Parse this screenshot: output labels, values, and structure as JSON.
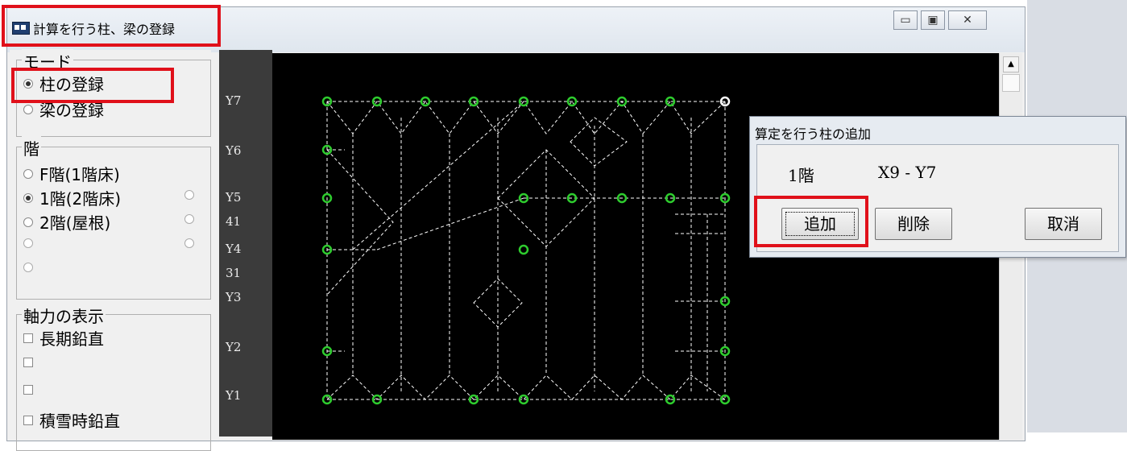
{
  "window": {
    "title": "計算を行う柱、梁の登録",
    "controls": {
      "minimize": "▭",
      "maximize": "▣",
      "close": "✕"
    }
  },
  "mode_group": {
    "title": "モード",
    "options": [
      {
        "label": "柱の登録",
        "selected": true
      },
      {
        "label": "梁の登録",
        "selected": false
      }
    ]
  },
  "floor_group": {
    "title": "階",
    "options": [
      {
        "label": "F階(1階床)",
        "selected": false
      },
      {
        "label": "1階(2階床)",
        "selected": true
      },
      {
        "label": "2階(屋根)",
        "selected": false
      }
    ]
  },
  "axial_group": {
    "title": "軸力の表示",
    "options": [
      {
        "label": "長期鉛直",
        "checked": false
      },
      {
        "label": "",
        "checked": false
      },
      {
        "label": "",
        "checked": false
      },
      {
        "label": "積雪時鉛直",
        "checked": false
      }
    ]
  },
  "axis_labels": [
    "Y7",
    "Y6",
    "Y5",
    "41",
    "Y4",
    "31",
    "Y3",
    "Y2",
    "Y1"
  ],
  "colors": {
    "column_marker": "#2ecc2e",
    "highlight": "#e0101a",
    "grid_line": "#ffffff"
  },
  "dialog": {
    "title": "算定を行う柱の追加",
    "floor": "1階",
    "position": "X9 - Y7",
    "buttons": {
      "add": "追加",
      "delete": "削除",
      "cancel": "取消"
    }
  }
}
